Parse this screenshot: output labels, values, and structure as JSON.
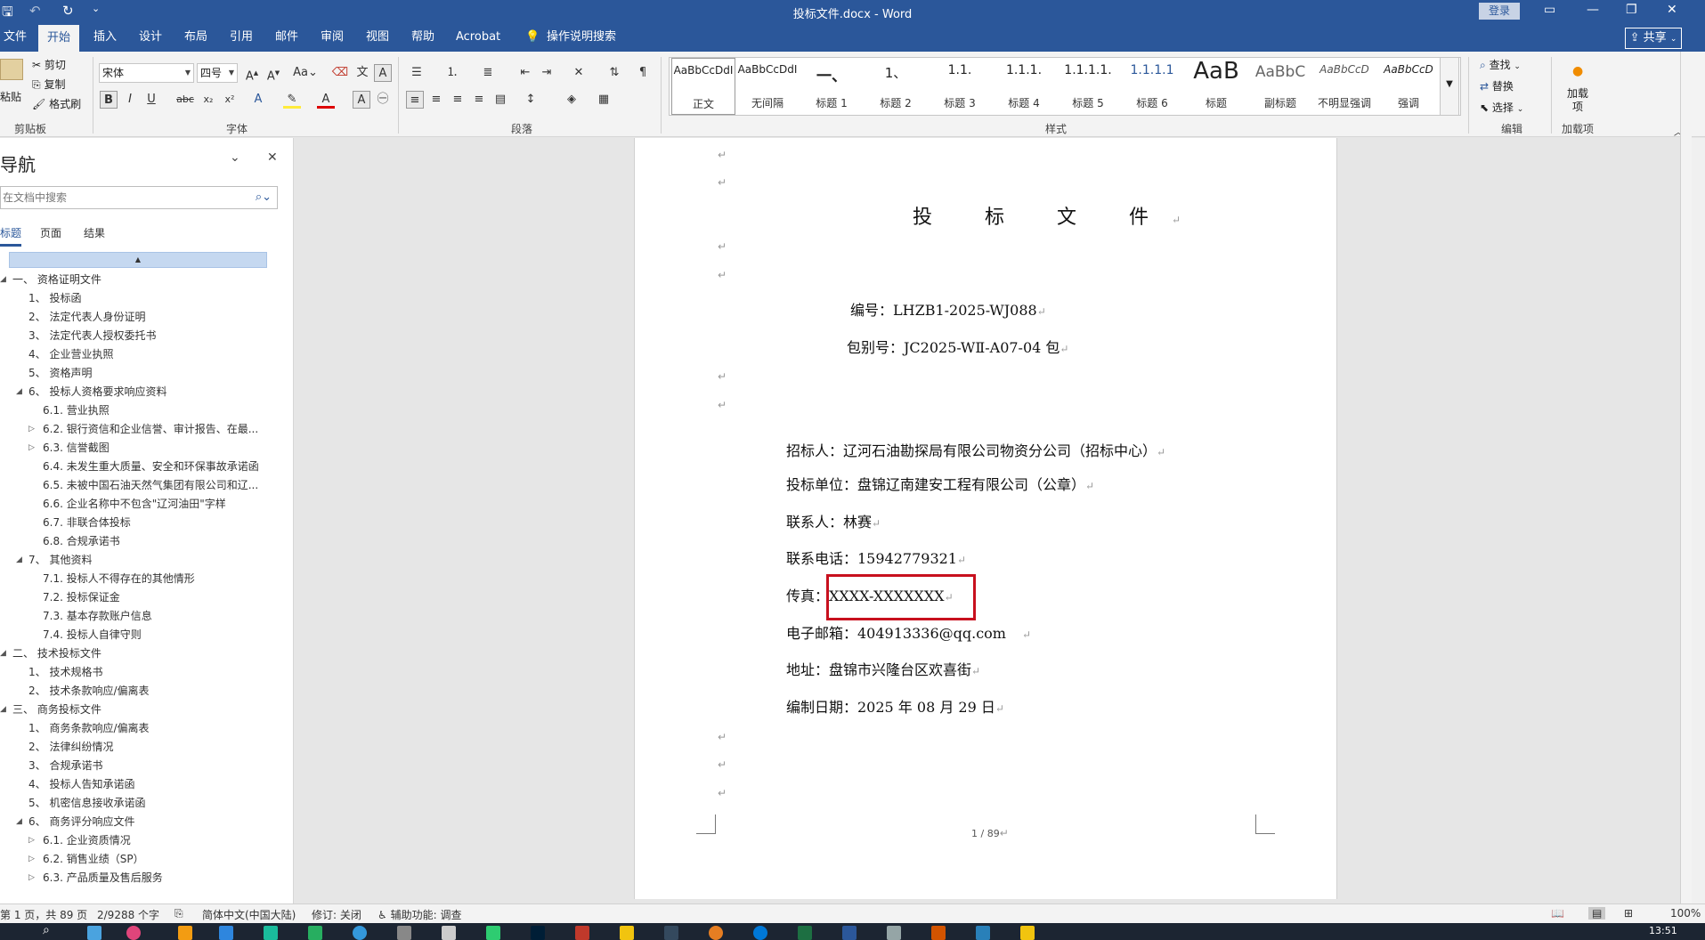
{
  "window": {
    "title": "投标文件.docx  -  Word",
    "login": "登录",
    "quick_access": [
      "save-icon",
      "undo-icon",
      "redo-icon",
      "customize-icon"
    ]
  },
  "ribbon_tabs": [
    "文件",
    "开始",
    "插入",
    "设计",
    "布局",
    "引用",
    "邮件",
    "审阅",
    "视图",
    "帮助",
    "Acrobat"
  ],
  "active_tab": "开始",
  "tell_me": "操作说明搜索",
  "share_label": "共享",
  "clipboard": {
    "paste": "粘贴",
    "cut": "剪切",
    "copy": "复制",
    "format_painter": "格式刷",
    "group_label": "剪贴板"
  },
  "font": {
    "name": "宋体",
    "size": "四号",
    "group_label": "字体"
  },
  "paragraph": {
    "group_label": "段落"
  },
  "styles": {
    "group_label": "样式",
    "items": [
      {
        "sample": "AaBbCcDdI",
        "name": "正文"
      },
      {
        "sample": "AaBbCcDdI",
        "name": "无间隔"
      },
      {
        "sample": "一、",
        "name": "标题 1"
      },
      {
        "sample": "1、",
        "name": "标题 2"
      },
      {
        "sample": "1.1.",
        "name": "标题 3"
      },
      {
        "sample": "1.1.1.",
        "name": "标题 4"
      },
      {
        "sample": "1.1.1.1.",
        "name": "标题 5"
      },
      {
        "sample": "1.1.1.1",
        "name": "标题 6"
      },
      {
        "sample": "AaB",
        "name": "标题"
      },
      {
        "sample": "AaBbC",
        "name": "副标题"
      },
      {
        "sample": "AaBbCcD",
        "name": "不明显强调"
      },
      {
        "sample": "AaBbCcD",
        "name": "强调"
      }
    ]
  },
  "editing": {
    "find": "查找",
    "replace": "替换",
    "select": "选择",
    "group_label": "编辑"
  },
  "addins": {
    "button": "加载项",
    "group_label": "加载项"
  },
  "nav": {
    "title": "导航",
    "search_placeholder": "在文档中搜索",
    "tabs": [
      "标题",
      "页面",
      "结果"
    ],
    "items": [
      {
        "text": "一、 资格证明文件",
        "arrow": "expanded"
      },
      {
        "text": "1、 投标函",
        "arrow": ""
      },
      {
        "text": "2、 法定代表人身份证明",
        "arrow": ""
      },
      {
        "text": "3、 法定代表人授权委托书",
        "arrow": ""
      },
      {
        "text": "4、 企业营业执照",
        "arrow": ""
      },
      {
        "text": "5、 资格声明",
        "arrow": ""
      },
      {
        "text": "6、 投标人资格要求响应资料",
        "arrow": "expanded"
      },
      {
        "text": "6.1. 营业执照",
        "arrow": ""
      },
      {
        "text": "6.2. 银行资信和企业信誉、审计报告、在最...",
        "arrow": "collapsed"
      },
      {
        "text": "6.3. 信誉截图",
        "arrow": "collapsed"
      },
      {
        "text": "6.4. 未发生重大质量、安全和环保事故承诺函",
        "arrow": ""
      },
      {
        "text": "6.5. 未被中国石油天然气集团有限公司和辽...",
        "arrow": ""
      },
      {
        "text": "6.6. 企业名称中不包含\"辽河油田\"字样",
        "arrow": ""
      },
      {
        "text": "6.7. 非联合体投标",
        "arrow": ""
      },
      {
        "text": "6.8. 合规承诺书",
        "arrow": ""
      },
      {
        "text": "7、 其他资料",
        "arrow": "expanded"
      },
      {
        "text": "7.1. 投标人不得存在的其他情形",
        "arrow": ""
      },
      {
        "text": "7.2. 投标保证金",
        "arrow": ""
      },
      {
        "text": "7.3. 基本存款账户信息",
        "arrow": ""
      },
      {
        "text": "7.4. 投标人自律守则",
        "arrow": ""
      },
      {
        "text": "二、 技术投标文件",
        "arrow": "expanded"
      },
      {
        "text": "1、 技术规格书",
        "arrow": ""
      },
      {
        "text": "2、 技术条款响应/偏离表",
        "arrow": ""
      },
      {
        "text": "三、 商务投标文件",
        "arrow": "expanded"
      },
      {
        "text": "1、 商务条款响应/偏离表",
        "arrow": ""
      },
      {
        "text": "2、 法律纠纷情况",
        "arrow": ""
      },
      {
        "text": "3、 合规承诺书",
        "arrow": ""
      },
      {
        "text": "4、 投标人告知承诺函",
        "arrow": ""
      },
      {
        "text": "5、 机密信息接收承诺函",
        "arrow": ""
      },
      {
        "text": "6、 商务评分响应文件",
        "arrow": "expanded"
      },
      {
        "text": "6.1. 企业资质情况",
        "arrow": "collapsed"
      },
      {
        "text": "6.2. 销售业绩（SP）",
        "arrow": "collapsed"
      },
      {
        "text": "6.3. 产品质量及售后服务",
        "arrow": "collapsed"
      }
    ]
  },
  "document": {
    "title": "投 标 文 件",
    "number": "编号：LHZB1-2025-WJ088",
    "package": "包别号：JC2025-WⅡ-A07-04 包",
    "tenderer": "招标人：辽河石油勘探局有限公司物资分公司（招标中心）",
    "bidder": "投标单位：盘锦辽南建安工程有限公司（公章）",
    "contact": "联系人：林赛",
    "phone": "联系电话：15942779321",
    "fax": "传真：XXXX-XXXXXXX",
    "email": "电子邮箱：404913336@qq.com",
    "address": "地址：盘锦市兴隆台区欢喜街",
    "date": "编制日期：2025 年 08 月 29 日",
    "page_number": "1 / 89",
    "para_mark": "↵"
  },
  "status": {
    "page": "第 1 页，共 89 页",
    "words": "2/9288 个字",
    "language": "简体中文(中国大陆)",
    "track_changes": "修订: 关闭",
    "accessibility": "辅助功能: 调查",
    "zoom": "100%"
  },
  "taskbar": {
    "time": "13:51"
  }
}
